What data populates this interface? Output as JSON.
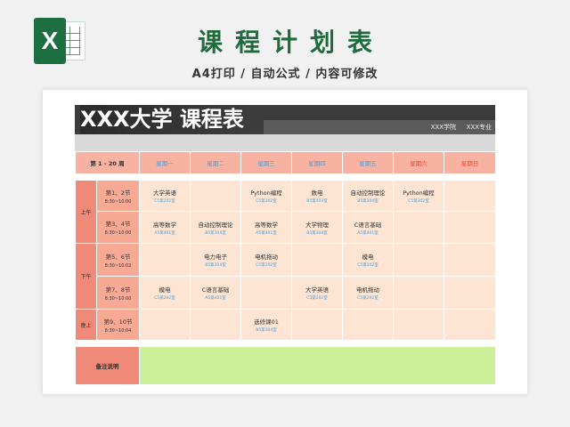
{
  "header": {
    "logo_letter": "X",
    "title": "课程计划表",
    "subtitle": "A4打印 / 自动公式 / 内容可修改"
  },
  "sheet": {
    "banner_title": "XXX大学  课程表",
    "school": "XXX学院",
    "major": "XXX专业",
    "week_range": "第 1 - 20 周",
    "weekdays": [
      "星期一",
      "星期二",
      "星期三",
      "星期四",
      "星期五",
      "星期六",
      "星期日"
    ],
    "periods": {
      "morning": "上午",
      "afternoon": "下午",
      "evening": "晚上"
    },
    "slots": [
      {
        "name": "第1、2节",
        "time": "8:30~10:00"
      },
      {
        "name": "第3、4节",
        "time": "8:30~10:00"
      },
      {
        "name": "第5、6节",
        "time": "8:30~10:02"
      },
      {
        "name": "第7、8节",
        "time": "8:30~10:00"
      },
      {
        "name": "第9、10节",
        "time": "8:30~10:04"
      }
    ],
    "rows": [
      [
        {
          "name": "大学英语",
          "room": "C5第202室"
        },
        {
          "name": "",
          "room": ""
        },
        {
          "name": "Python编程",
          "room": "C5第302室"
        },
        {
          "name": "数电",
          "room": "B5第403室"
        },
        {
          "name": "自动控制理论",
          "room": "B5第304室"
        },
        {
          "name": "Python编程",
          "room": "C5第302室"
        },
        {
          "name": "",
          "room": ""
        }
      ],
      [
        {
          "name": "高等数学",
          "room": "A5第401室"
        },
        {
          "name": "自动控制理论",
          "room": "B5第304室"
        },
        {
          "name": "高等数学",
          "room": "A5第401室"
        },
        {
          "name": "大学物理",
          "room": "B5第304室"
        },
        {
          "name": "C语言基础",
          "room": "A5第401室"
        },
        {
          "name": "",
          "room": ""
        },
        {
          "name": "",
          "room": ""
        }
      ],
      [
        {
          "name": "",
          "room": ""
        },
        {
          "name": "电力电子",
          "room": "B5第304室"
        },
        {
          "name": "电机拖动",
          "room": "C5第202室"
        },
        {
          "name": "",
          "room": ""
        },
        {
          "name": "模电",
          "room": "C5第202室"
        },
        {
          "name": "",
          "room": ""
        },
        {
          "name": "",
          "room": ""
        }
      ],
      [
        {
          "name": "模电",
          "room": "C5第202室"
        },
        {
          "name": "C语言基础",
          "room": "A5第401室"
        },
        {
          "name": "",
          "room": ""
        },
        {
          "name": "大学英语",
          "room": "C5第202室"
        },
        {
          "name": "电机拖动",
          "room": "C5第202室"
        },
        {
          "name": "",
          "room": ""
        },
        {
          "name": "",
          "room": ""
        }
      ],
      [
        {
          "name": "",
          "room": ""
        },
        {
          "name": "",
          "room": ""
        },
        {
          "name": "选修课01",
          "room": "B5第304室"
        },
        {
          "name": "",
          "room": ""
        },
        {
          "name": "",
          "room": ""
        },
        {
          "name": "",
          "room": ""
        },
        {
          "name": "",
          "room": ""
        }
      ]
    ],
    "notes_label": "备注说明"
  },
  "colors": {
    "brand_green": "#1f6b3d",
    "header_salmon": "#f7b2a1",
    "cell_peach": "#fde4d3",
    "notes_green": "#ccf09a",
    "weekday_blue": "#4a9fd8",
    "weekend_red": "#e8463a"
  }
}
